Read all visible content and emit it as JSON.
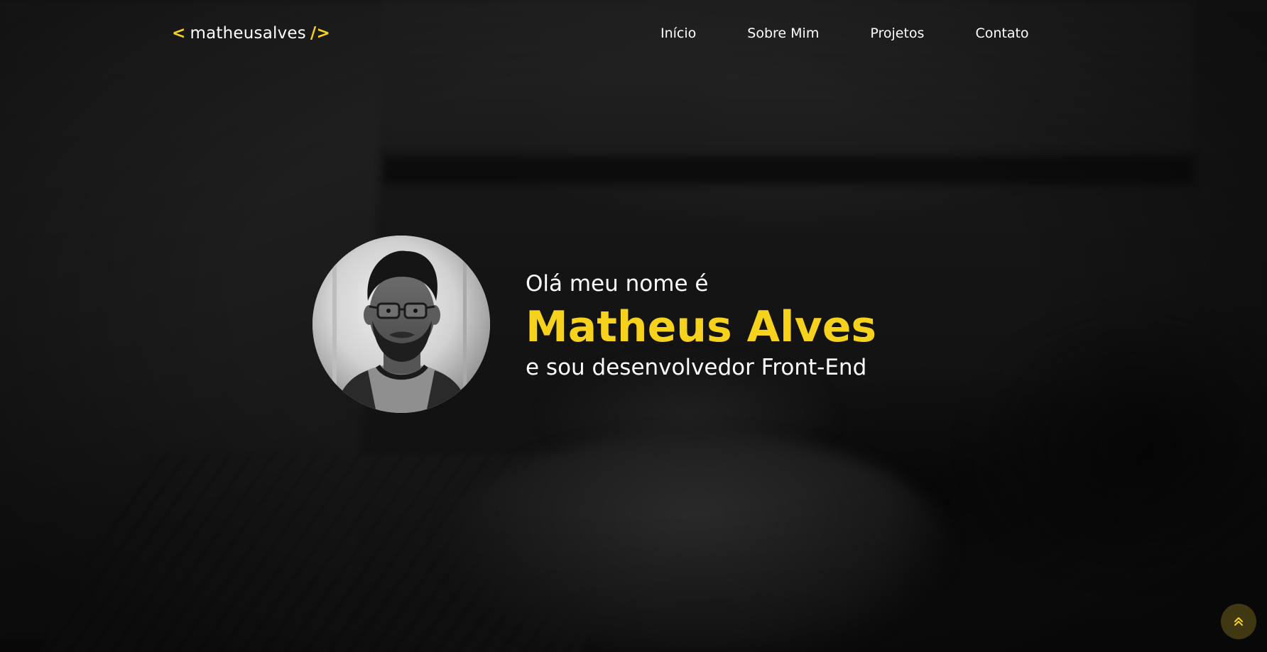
{
  "header": {
    "logo": {
      "open_bracket": "<",
      "name": "matheusalves",
      "close_bracket": "/>"
    },
    "nav": [
      {
        "label": "Início"
      },
      {
        "label": "Sobre Mim"
      },
      {
        "label": "Projetos"
      },
      {
        "label": "Contato"
      }
    ]
  },
  "hero": {
    "greeting": "Olá meu nome é",
    "name": "Matheus Alves",
    "role": "e sou desenvolvedor Front-End",
    "avatar_icon": "profile-photo"
  },
  "back_to_top": {
    "icon": "double-chevron-up-icon"
  },
  "colors": {
    "accent": "#f7d21c",
    "text": "#ffffff",
    "background": "#141414",
    "back_to_top_bg": "#3f3812"
  }
}
